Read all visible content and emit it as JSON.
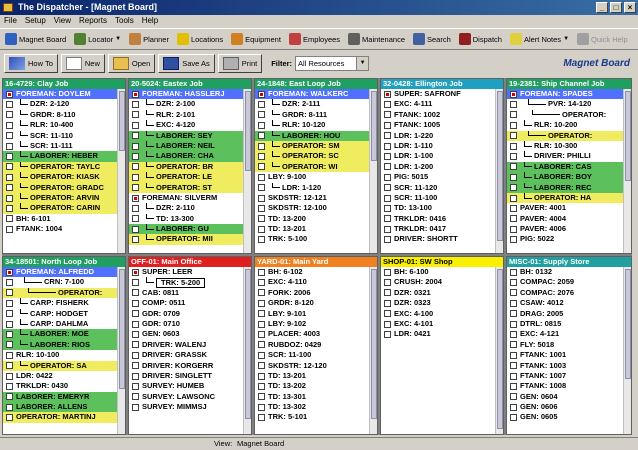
{
  "window": {
    "title": "The Dispatcher - [Magnet Board]"
  },
  "menu": [
    "File",
    "Setup",
    "View",
    "Reports",
    "Tools",
    "Help"
  ],
  "toolbar": [
    {
      "label": "Magnet Board",
      "icon": "magnet-board-icon",
      "color": "#3060c0"
    },
    {
      "label": "Locator",
      "icon": "locator-icon",
      "color": "#508030",
      "dropdown": true
    },
    {
      "label": "Planner",
      "icon": "planner-icon",
      "color": "#c08040"
    },
    {
      "label": "Locations",
      "icon": "locations-icon",
      "color": "#e0c000"
    },
    {
      "label": "Equipment",
      "icon": "equipment-icon",
      "color": "#d08020"
    },
    {
      "label": "Employees",
      "icon": "employees-icon",
      "color": "#c04040"
    },
    {
      "label": "Maintenance",
      "icon": "maintenance-icon",
      "color": "#606060"
    },
    {
      "label": "Search",
      "icon": "search-icon",
      "color": "#4060a0"
    },
    {
      "label": "Dispatch",
      "icon": "dispatch-icon",
      "color": "#902020"
    },
    {
      "label": "Alert Notes",
      "icon": "alert-notes-icon",
      "color": "#e0d040",
      "dropdown": true
    },
    {
      "label": "Quick Help",
      "icon": "quick-help-icon",
      "color": "#a0a0a0",
      "disabled": true
    }
  ],
  "toolbar2": {
    "how_to": "How To",
    "new": "New",
    "open": "Open",
    "save_as": "Save As",
    "print": "Print",
    "filter_label": "Filter:",
    "filter_value": "All Resources"
  },
  "brand": "Magnet Board",
  "colors": {
    "green": "#008000",
    "red": "#e00000",
    "orange": "#f08020",
    "yellow": "#f8f000",
    "teal": "#20a0a0",
    "blue": "#4070c0"
  },
  "panels": [
    {
      "title": "16-4729: Clay Job",
      "color": "#20a060",
      "dark": false,
      "rows": [
        {
          "t": "FOREMAN: DOYLEM",
          "cb": "red",
          "hl": "blue"
        },
        {
          "t": "DZR: 2-120",
          "ind": 1
        },
        {
          "t": "GRDR: 8-110",
          "ind": 1
        },
        {
          "t": "RLR: 10-400",
          "ind": 1
        },
        {
          "t": "SCR: 11-110",
          "ind": 1
        },
        {
          "t": "SCR: 11-111",
          "ind": 1
        },
        {
          "t": "LABORER: HEBER",
          "ind": 1,
          "hl": "green"
        },
        {
          "t": "OPERATOR: TAYLC",
          "ind": 1,
          "hl": "yellow"
        },
        {
          "t": "OPERATOR: KIASK",
          "ind": 1,
          "hl": "yellow"
        },
        {
          "t": "OPERATOR: GRADC",
          "ind": 1,
          "hl": "yellow"
        },
        {
          "t": "OPERATOR: ARVIN",
          "ind": 1,
          "hl": "yellow"
        },
        {
          "t": "OPERATOR: CARIN",
          "ind": 1,
          "hl": "yellow"
        },
        {
          "t": "BH: 6-101"
        },
        {
          "t": "FTANK: 1004"
        }
      ]
    },
    {
      "title": "20-5024: Eastex Job",
      "color": "#20a060",
      "dark": false,
      "rows": [
        {
          "t": "FOREMAN: HASSLERJ",
          "cb": "red",
          "hl": "blue"
        },
        {
          "t": "DZR: 2-100",
          "ind": 1
        },
        {
          "t": "RLR: 2-101",
          "ind": 1
        },
        {
          "t": "EXC: 4-120",
          "ind": 1
        },
        {
          "t": "LABORER: SEY",
          "ind": 1,
          "hl": "green"
        },
        {
          "t": "LABORER: NEIL",
          "ind": 1,
          "hl": "green"
        },
        {
          "t": "LABORER: CHA",
          "ind": 1,
          "hl": "green"
        },
        {
          "t": "OPERATOR: BR",
          "ind": 1,
          "hl": "yellow"
        },
        {
          "t": "OPERATOR: LE",
          "ind": 1,
          "hl": "yellow"
        },
        {
          "t": "OPERATOR: ST",
          "ind": 1,
          "hl": "yellow"
        },
        {
          "t": "FOREMAN: SILVERM",
          "cb": "red"
        },
        {
          "t": "DZR: 2-110",
          "ind": 1
        },
        {
          "t": "TD: 13-300",
          "ind": 1
        },
        {
          "t": "LABORER: GU",
          "ind": 1,
          "hl": "green"
        },
        {
          "t": "OPERATOR: MII",
          "ind": 1,
          "hl": "yellow"
        }
      ]
    },
    {
      "title": "24-1848: East Loop Job",
      "color": "#20a060",
      "dark": false,
      "rows": [
        {
          "t": "FOREMAN: WALKERC",
          "cb": "red",
          "hl": "blue"
        },
        {
          "t": "DZR: 2-111",
          "ind": 1
        },
        {
          "t": "GRDR: 8-111",
          "ind": 1
        },
        {
          "t": "RLR: 10-120",
          "ind": 1
        },
        {
          "t": "LABORER: HOU",
          "ind": 1,
          "hl": "green"
        },
        {
          "t": "OPERATOR: SM",
          "ind": 1,
          "hl": "yellow"
        },
        {
          "t": "OPERATOR: SC",
          "ind": 1,
          "hl": "yellow"
        },
        {
          "t": "OPERATOR: WI",
          "ind": 1,
          "hl": "yellow"
        },
        {
          "t": "LBY: 9-100"
        },
        {
          "t": "LDR: 1-120",
          "ind": 1
        },
        {
          "t": "SKDSTR: 12-121"
        },
        {
          "t": "SKDSTR: 12-100"
        },
        {
          "t": "TD: 13-200"
        },
        {
          "t": "TD: 13-201"
        },
        {
          "t": "TRK: 5-100"
        }
      ]
    },
    {
      "title": "32-0428: Ellington Job",
      "color": "#20a0c0",
      "dark": false,
      "rows": [
        {
          "t": "SUPER: SAFRONF",
          "cb": "red"
        },
        {
          "t": "EXC: 4-111"
        },
        {
          "t": "FTANK: 1002"
        },
        {
          "t": "FTANK: 1005"
        },
        {
          "t": "LDR: 1-220"
        },
        {
          "t": "LDR: 1-110"
        },
        {
          "t": "LDR: 1-100"
        },
        {
          "t": "LDR: 1-200"
        },
        {
          "t": "PIG: 5015"
        },
        {
          "t": "SCR: 11-120"
        },
        {
          "t": "SCR: 11-100"
        },
        {
          "t": "TD: 13-100"
        },
        {
          "t": "TRKLDR: 0416"
        },
        {
          "t": "TRKLDR: 0417"
        },
        {
          "t": "DRIVER: SHORTT"
        }
      ]
    },
    {
      "title": "19-2381: Ship Channel Job",
      "color": "#20a060",
      "dark": false,
      "rows": [
        {
          "t": "FOREMAN: SPADES",
          "cb": "red",
          "hl": "blue"
        },
        {
          "t": "PVR: 14-120",
          "ind": 2
        },
        {
          "t": "OPERATOR:",
          "ind": 3
        },
        {
          "t": "RLR: 10-200",
          "ind": 1
        },
        {
          "t": "OPERATOR:",
          "ind": 2,
          "hl": "yellow"
        },
        {
          "t": "RLR: 10-300",
          "ind": 1
        },
        {
          "t": "DRIVER: PHILLI",
          "ind": 1
        },
        {
          "t": "LABORER: CAS",
          "ind": 1,
          "hl": "green"
        },
        {
          "t": "LABORER: BOY",
          "ind": 1,
          "hl": "green"
        },
        {
          "t": "LABORER: REC",
          "ind": 1,
          "hl": "green"
        },
        {
          "t": "OPERATOR: HA",
          "ind": 1,
          "hl": "yellow"
        },
        {
          "t": "PAVER: 4001"
        },
        {
          "t": "PAVER: 4004"
        },
        {
          "t": "PAVER: 4006"
        },
        {
          "t": "PIG: 5022"
        }
      ]
    },
    {
      "title": "34-18501: North Loop Job",
      "color": "#20a060",
      "dark": false,
      "rows": [
        {
          "t": "FOREMAN: ALFREDD",
          "cb": "red",
          "hl": "blue"
        },
        {
          "t": "CRN: 7-100",
          "ind": 2
        },
        {
          "t": "OPERATOR:",
          "ind": 3,
          "hl": "yellow"
        },
        {
          "t": "CARP: FISHERK",
          "ind": 1
        },
        {
          "t": "CARP: HODGET",
          "ind": 1
        },
        {
          "t": "CARP: DAHLMA",
          "ind": 1
        },
        {
          "t": "LABORER: MOE",
          "ind": 1,
          "hl": "green"
        },
        {
          "t": "LABORER: RIOS",
          "ind": 1,
          "hl": "green"
        },
        {
          "t": "RLR: 10-100"
        },
        {
          "t": "OPERATOR: SA",
          "ind": 1,
          "hl": "yellow"
        },
        {
          "t": "LDR: 0422"
        },
        {
          "t": "TRKLDR: 0430"
        },
        {
          "t": "LABORER: EMERYR",
          "hl": "green"
        },
        {
          "t": "LABORER: ALLENS",
          "hl": "green"
        },
        {
          "t": "OPERATOR: MARTINJ",
          "hl": "yellow"
        }
      ]
    },
    {
      "title": "OFF-01: Main Office",
      "color": "#e02020",
      "dark": false,
      "rows": [
        {
          "t": "SUPER: LEER",
          "cb": "red"
        },
        {
          "t": "TRK: 5-200",
          "ind": 1,
          "boxed": true
        },
        {
          "t": "CAB: 0811"
        },
        {
          "t": "COMP: 0511"
        },
        {
          "t": "GDR: 0709"
        },
        {
          "t": "GDR: 0710"
        },
        {
          "t": "GEN: 0603"
        },
        {
          "t": "DRIVER: WALENJ"
        },
        {
          "t": "DRIVER: GRASSK"
        },
        {
          "t": "DRIVER: KORGERR"
        },
        {
          "t": "DRIVER: SINGLETT"
        },
        {
          "t": "SURVEY: HUMEB"
        },
        {
          "t": "SURVEY: LAWSONC"
        },
        {
          "t": "SURVEY: MIMMSJ"
        }
      ]
    },
    {
      "title": "YARD-01: Main Yard",
      "color": "#f08020",
      "dark": false,
      "rows": [
        {
          "t": "BH: 6-102"
        },
        {
          "t": "EXC: 4-110"
        },
        {
          "t": "FORK: 2006"
        },
        {
          "t": "GRDR: 8-120"
        },
        {
          "t": "LBY: 9-101"
        },
        {
          "t": "LBY: 9-102"
        },
        {
          "t": "PLACER: 4003"
        },
        {
          "t": "RUBDOZ: 0429"
        },
        {
          "t": "SCR: 11-100"
        },
        {
          "t": "SKDSTR: 12-120"
        },
        {
          "t": "TD: 13-201"
        },
        {
          "t": "TD: 13-202"
        },
        {
          "t": "TD: 13-301"
        },
        {
          "t": "TD: 13-302"
        },
        {
          "t": "TRK: 5-101"
        }
      ]
    },
    {
      "title": "SHOP-01: SW Shop",
      "color": "#f8f000",
      "dark": true,
      "rows": [
        {
          "t": "BH: 6-100"
        },
        {
          "t": "CRUSH: 2004"
        },
        {
          "t": "DZR: 0321"
        },
        {
          "t": "DZR: 0323"
        },
        {
          "t": "EXC: 4-100"
        },
        {
          "t": "EXC: 4-101"
        },
        {
          "t": "LDR: 0421"
        }
      ]
    },
    {
      "title": "MISC-01: Supply Store",
      "color": "#20a0a0",
      "dark": false,
      "rows": [
        {
          "t": "BH: 0132"
        },
        {
          "t": "COMPAC: 2059"
        },
        {
          "t": "COMPAC: 2076"
        },
        {
          "t": "CSAW: 4012"
        },
        {
          "t": "DRAG: 2005"
        },
        {
          "t": "DTRL: 0815"
        },
        {
          "t": "EXC: 4-121"
        },
        {
          "t": "FLY: 5018"
        },
        {
          "t": "FTANK: 1001"
        },
        {
          "t": "FTANK: 1003"
        },
        {
          "t": "FTANK: 1007"
        },
        {
          "t": "FTANK: 1008"
        },
        {
          "t": "GEN: 0604"
        },
        {
          "t": "GEN: 0606"
        },
        {
          "t": "GEN: 0605"
        }
      ]
    }
  ],
  "status": {
    "view_label": "View:",
    "view_value": "Magnet Board"
  }
}
